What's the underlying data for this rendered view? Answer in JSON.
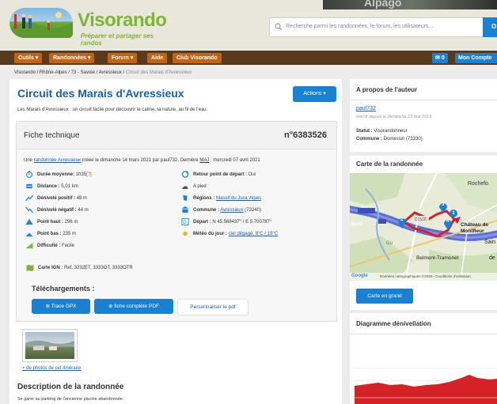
{
  "header": {
    "logo_text": "Visorando",
    "logo_tagline": "Préparer et partager ses randos",
    "top_photo_text": "Alpago",
    "search_placeholder": "Recherche parmi les randonnées, le forum, les utilisateurs...",
    "search_button": "O"
  },
  "nav": {
    "items": [
      "Outils",
      "Randonnées",
      "Forum",
      "Aide",
      "Club Visorando"
    ],
    "messages_count": "0",
    "account_label": "Mon Compte"
  },
  "breadcrumb": {
    "path": "Visorando / Rhône-Alpes / 73 - Savoie / Avressieux /",
    "current": "Circuit des Marais d'Avressieux"
  },
  "main": {
    "title": "Circuit des Marais d'Avressieux",
    "actions_label": "Actions",
    "subtitle": "Les Marais d'Avressieux : un circuit facile pour découvrir le calme, la nature, au fil de l'eau.",
    "fiche_title": "Fiche technique",
    "fiche_number": "n°6383526",
    "intro": {
      "prefix": "Une",
      "link": "randonnée Avressieux",
      "middle": "créée le dimanche 14 mars 2021 par paul732. Dernière",
      "maj": "MAJ",
      "suffix": ": mercredi 07 avril 2021"
    },
    "stats_left": [
      {
        "label": "Durée moyenne:",
        "value": "1h35",
        "extra": "[?]",
        "icon": "stopwatch-icon"
      },
      {
        "label": "Distance :",
        "value": "5,01 km",
        "icon": "distance-icon"
      },
      {
        "label": "Dénivelé positif :",
        "value": "48 m",
        "icon": "elevation-up-icon"
      },
      {
        "label": "Dénivelé négatif :",
        "value": "44 m",
        "icon": "elevation-down-icon"
      },
      {
        "label": "Point haut :",
        "value": "296 m",
        "icon": "high-point-icon"
      },
      {
        "label": "Point bas :",
        "value": "235 m",
        "icon": "low-point-icon"
      },
      {
        "label": "Difficulté :",
        "value": "Facile",
        "icon": "difficulty-icon"
      }
    ],
    "stats_right": [
      {
        "label": "Retour point de départ :",
        "value": "Oui",
        "icon": "loop-icon"
      },
      {
        "label": "",
        "value": "A pied",
        "icon": "walker-icon"
      },
      {
        "label": "Régions :",
        "value": "Massif du Jura, Alpes",
        "icon": "region-icon"
      },
      {
        "label": "Commune :",
        "value": "Avressieux",
        "extra": "(73240)",
        "icon": "town-hall-icon"
      },
      {
        "label": "Départ :",
        "value": "N 45.568437° / E 5.700787°",
        "icon": "start-point-icon"
      },
      {
        "label": "Météo du jour :",
        "value": "ciel dégagé, 8°C / 19°C",
        "icon": "sun-icon"
      }
    ],
    "carte_ign": {
      "label": "Carte IGN :",
      "value": "Ref. 3232ET, 3333OT, 3333OTR"
    },
    "downloads_title": "Téléchargements :",
    "download_buttons": [
      "Trace GPX",
      "fiche complète PDF",
      "Personnaliser le pdf"
    ],
    "photos_link": "+ de photos de cet itinéraire",
    "description_title": "Description de la randonnée",
    "description_text": "Se garer au parking de l'ancienne piscine abandonnée."
  },
  "sidebar": {
    "author": {
      "title": "A propos de l'auteur",
      "name": "paul732",
      "since": "Inscrit depuis le dimanche 19 mai 2019",
      "status_label": "Statut :",
      "status_value": "Visorandonneur",
      "commune_label": "Commune :",
      "commune_value": "Domessin (73330)"
    },
    "map": {
      "title": "Carte de la randonnée",
      "button": "Carte en grand",
      "labels": [
        "Rochefo",
        "Château de Montfleur",
        "Belmont-Tramonet",
        "Saint",
        "Sain",
        "de",
        "Gu",
        "D1516"
      ],
      "markers": [
        "1",
        "2",
        "3",
        "4"
      ],
      "attribution": "Données cartographiques ©2020 - Conditions d'utilisation",
      "google": "Google"
    },
    "elevation": {
      "title": "Diagramme dénivellation"
    },
    "colors": {
      "accent": "#1a80d1",
      "nav_bg": "#5a3a1d",
      "nav_item": "#c06418",
      "logo": "#7fb439"
    }
  }
}
